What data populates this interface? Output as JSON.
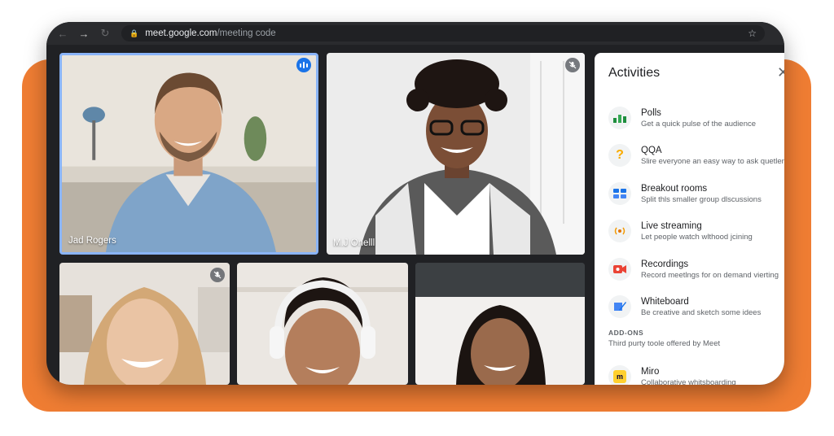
{
  "browser": {
    "url_host": "meet.google.com",
    "url_path": "/meeting code"
  },
  "participants": [
    {
      "name": "Jad Rogers",
      "speaking": true,
      "muted": false
    },
    {
      "name": "M.J Onelll",
      "speaking": false,
      "muted": true
    },
    {
      "name": "",
      "speaking": false,
      "muted": true
    },
    {
      "name": "",
      "speaking": false,
      "muted": false
    },
    {
      "name": "",
      "speaking": false,
      "muted": false
    }
  ],
  "panel": {
    "title": "Activities",
    "items": [
      {
        "label": "Polls",
        "desc": "Get a quick pulse of the audience",
        "icon": "polls-icon"
      },
      {
        "label": "QQA",
        "desc": "Slire everyone an easy way to ask quetlence",
        "icon": "question-icon"
      },
      {
        "label": "Breakout rooms",
        "desc": "Split thls smaller group dlscussions",
        "icon": "breakout-rooms-icon"
      },
      {
        "label": "Live streaming",
        "desc": "Let people watch wlthood jcining",
        "icon": "live-streaming-icon"
      },
      {
        "label": "Recordings",
        "desc": "Record meetlngs for on demand vierting",
        "icon": "recording-icon"
      },
      {
        "label": "Whiteboard",
        "desc": "Be creative and sketch some idees",
        "icon": "whiteboard-icon"
      }
    ],
    "addons_heading": "ADD-ONS",
    "addons_desc": "Third purty toole offered by Meet",
    "addons": [
      {
        "label": "Miro",
        "desc": "Collaborative whitsboarding",
        "icon": "miro-icon"
      }
    ]
  },
  "colors": {
    "accent": "#1a73e8",
    "speaking_border": "#8ab4f8",
    "backdrop": "#ef7d33"
  }
}
